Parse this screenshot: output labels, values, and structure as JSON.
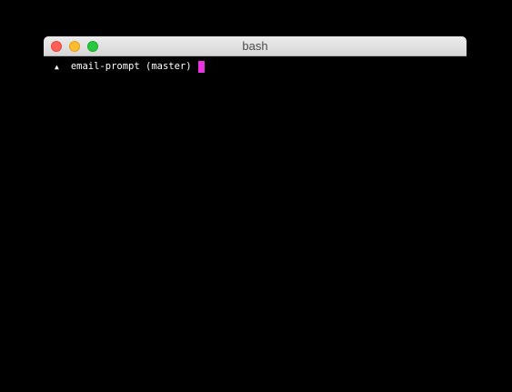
{
  "window": {
    "title": "bash"
  },
  "terminal": {
    "prompt_symbol": "▲",
    "prompt_text": "email-prompt (master)",
    "cursor_color": "#e833e0"
  },
  "colors": {
    "background": "#000000",
    "text": "#ffffff"
  }
}
